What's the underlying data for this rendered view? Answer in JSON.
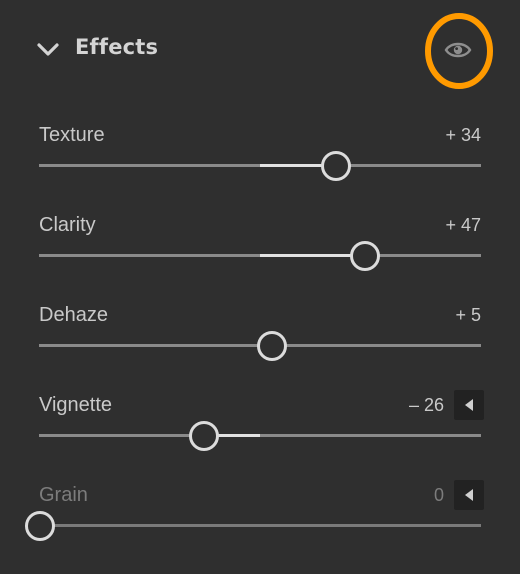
{
  "panel": {
    "title": "Effects",
    "toggle_icon": "eye-icon",
    "highlight_color": "#ff9a00"
  },
  "controls": [
    {
      "label": "Texture",
      "value": "+ 34",
      "amount": 34,
      "reset": false,
      "disabled": false
    },
    {
      "label": "Clarity",
      "value": "+ 47",
      "amount": 47,
      "reset": false,
      "disabled": false
    },
    {
      "label": "Dehaze",
      "value": "+ 5",
      "amount": 5,
      "reset": false,
      "disabled": false
    },
    {
      "label": "Vignette",
      "value": "– 26",
      "amount": -26,
      "reset": true,
      "disabled": false
    },
    {
      "label": "Grain",
      "value": "0",
      "amount": 0,
      "reset": true,
      "disabled": true
    }
  ]
}
